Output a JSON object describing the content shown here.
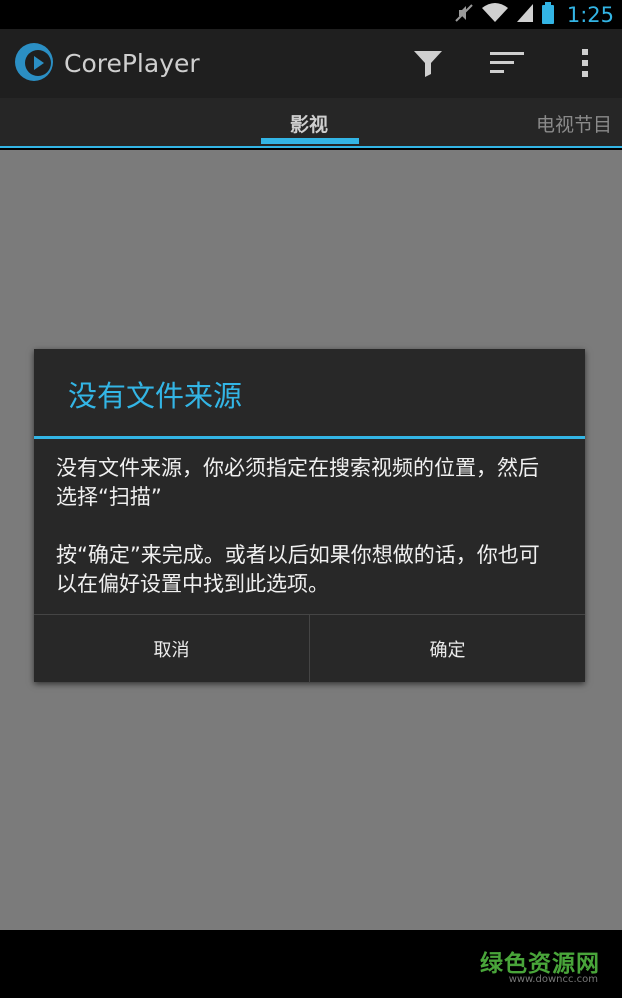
{
  "status_bar": {
    "time": "1:25",
    "icons": [
      "mute-icon",
      "wifi-icon",
      "signal-icon",
      "battery-icon"
    ]
  },
  "action_bar": {
    "title": "CorePlayer",
    "actions": [
      "filter-icon",
      "sort-icon",
      "overflow-menu-icon"
    ]
  },
  "tabs": {
    "active": "影视",
    "next": "电视节目"
  },
  "dialog": {
    "title": "没有文件来源",
    "message_line1": "没有文件来源，你必须指定在搜索视频的位置，然后选择“扫描”",
    "message_line2": "按“确定”来完成。或者以后如果你想做的话，你也可以在偏好设置中找到此选项。",
    "cancel_label": "取消",
    "ok_label": "确定"
  },
  "watermark": {
    "logo": "绿色资源网",
    "url": "www.downcc.com"
  },
  "colors": {
    "accent": "#33b5e5",
    "dialog_bg": "#282828",
    "content_bg": "#7b7b7b",
    "watermark": "#49a53a"
  }
}
